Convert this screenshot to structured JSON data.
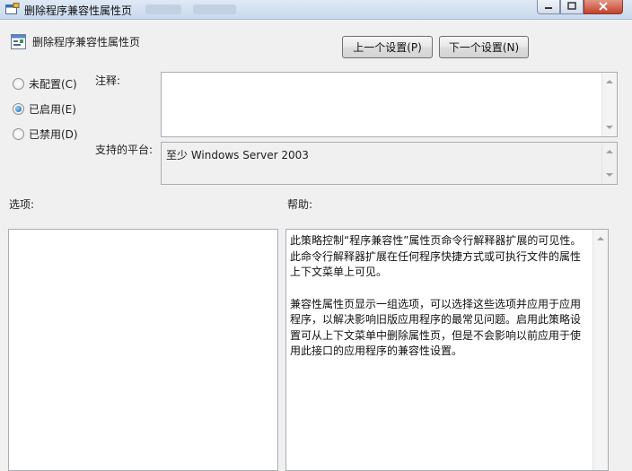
{
  "window": {
    "title": "删除程序兼容性属性页",
    "background_tabs": [
      "",
      ""
    ]
  },
  "header": {
    "policy_title": "删除程序兼容性属性页",
    "prev_button": "上一个设置(P)",
    "next_button": "下一个设置(N)"
  },
  "state": {
    "options": [
      {
        "label": "未配置(C)",
        "selected": false
      },
      {
        "label": "已启用(E)",
        "selected": true
      },
      {
        "label": "已禁用(D)",
        "selected": false
      }
    ]
  },
  "comment": {
    "label": "注释:",
    "value": ""
  },
  "platform": {
    "label": "支持的平台:",
    "value": "至少 Windows Server 2003"
  },
  "options_section": {
    "label": "选项:"
  },
  "help_section": {
    "label": "帮助:",
    "paragraphs": [
      "此策略控制“程序兼容性”属性页命令行解释器扩展的可见性。此命令行解释器扩展在任何程序快捷方式或可执行文件的属性上下文菜单上可见。",
      "兼容性属性页显示一组选项，可以选择这些选项并应用于应用程序，以解决影响旧版应用程序的最常见问题。启用此策略设置可从上下文菜单中删除属性页，但是不会影响以前应用于使用此接口的应用程序的兼容性设置。"
    ]
  },
  "colors": {
    "accent": "#1c5fa8",
    "titlebar": "#c9d9ec",
    "close": "#c4402b"
  }
}
